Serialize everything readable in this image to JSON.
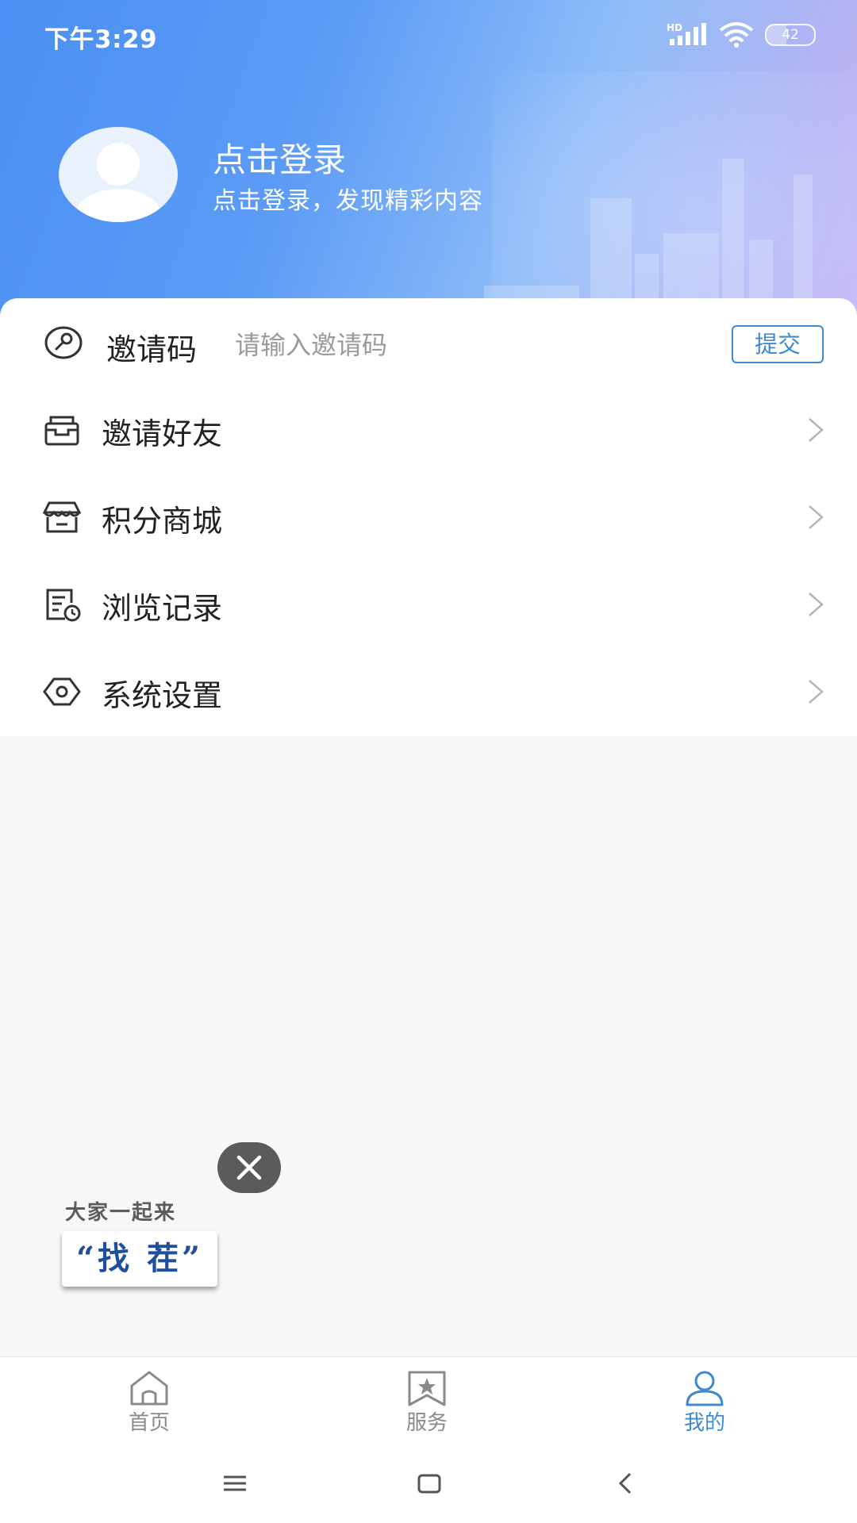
{
  "status_bar": {
    "time": "下午3:29",
    "network_label": "HD",
    "battery": "42"
  },
  "header": {
    "login_title": "点击登录",
    "login_subtitle": "点击登录，发现精彩内容"
  },
  "invite": {
    "label": "邀请码",
    "placeholder": "请输入邀请码",
    "value": "",
    "submit_label": "提交"
  },
  "menu": [
    {
      "label": "邀请好友",
      "icon": "inbox-icon"
    },
    {
      "label": "积分商城",
      "icon": "store-icon"
    },
    {
      "label": "浏览记录",
      "icon": "history-icon"
    },
    {
      "label": "系统设置",
      "icon": "settings-icon"
    }
  ],
  "float_ad": {
    "line1": "大家一起来",
    "line2": "“找 茬”"
  },
  "tabbar": [
    {
      "label": "首页",
      "icon": "home-icon",
      "active": false
    },
    {
      "label": "服务",
      "icon": "star-bookmark-icon",
      "active": false
    },
    {
      "label": "我的",
      "icon": "user-icon",
      "active": true
    }
  ],
  "colors": {
    "accent": "#3d89d2",
    "header_start": "#4a8ff3",
    "header_end": "#c9b6f4",
    "page_bg": "#f7f7f8"
  }
}
